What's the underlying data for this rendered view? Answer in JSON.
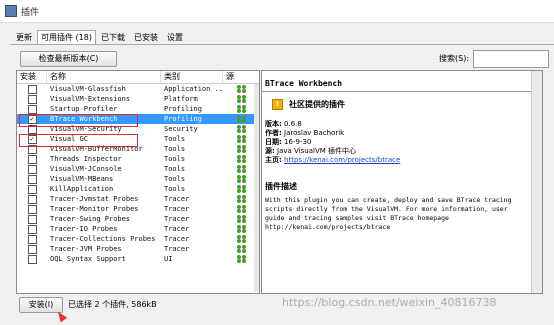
{
  "window": {
    "title": "插件"
  },
  "tabs": [
    "更新",
    "可用插件 (18)",
    "已下载",
    "已安装",
    "设置"
  ],
  "toolbar": {
    "check_label": "检查最新版本(C)",
    "search_label": "搜索(S):",
    "search_value": ""
  },
  "list": {
    "headers": {
      "install": "安装",
      "name": "名称",
      "category": "类别",
      "source": "源"
    },
    "rows": [
      {
        "checked": false,
        "name": "VisualVM-Glassfish",
        "category": "Application ...",
        "selected": false
      },
      {
        "checked": false,
        "name": "VisualVM-Extensions",
        "category": "Platform",
        "selected": false
      },
      {
        "checked": false,
        "name": "Startup Profiler",
        "category": "Profiling",
        "selected": false
      },
      {
        "checked": true,
        "name": "BTrace Workbench",
        "category": "Profiling",
        "selected": true
      },
      {
        "checked": false,
        "name": "VisualVM-Security",
        "category": "Security",
        "selected": false
      },
      {
        "checked": true,
        "name": "Visual GC",
        "category": "Tools",
        "selected": false
      },
      {
        "checked": false,
        "name": "VisualVM-BufferMonitor",
        "category": "Tools",
        "selected": false
      },
      {
        "checked": false,
        "name": "Threads Inspector",
        "category": "Tools",
        "selected": false
      },
      {
        "checked": false,
        "name": "VisualVM-JConsole",
        "category": "Tools",
        "selected": false
      },
      {
        "checked": false,
        "name": "VisualVM-MBeans",
        "category": "Tools",
        "selected": false
      },
      {
        "checked": false,
        "name": "KillApplication",
        "category": "Tools",
        "selected": false
      },
      {
        "checked": false,
        "name": "Tracer-Jvmstat Probes",
        "category": "Tracer",
        "selected": false
      },
      {
        "checked": false,
        "name": "Tracer-Monitor Probes",
        "category": "Tracer",
        "selected": false
      },
      {
        "checked": false,
        "name": "Tracer-Swing Probes",
        "category": "Tracer",
        "selected": false
      },
      {
        "checked": false,
        "name": "Tracer-IO Probes",
        "category": "Tracer",
        "selected": false
      },
      {
        "checked": false,
        "name": "Tracer-Collections Probes",
        "category": "Tracer",
        "selected": false
      },
      {
        "checked": false,
        "name": "Tracer-JVM Probes",
        "category": "Tracer",
        "selected": false
      },
      {
        "checked": false,
        "name": "OQL Syntax Support",
        "category": "UI",
        "selected": false
      }
    ]
  },
  "detail": {
    "title": "BTrace Workbench",
    "badge": "社区提供的插件",
    "version_label": "版本:",
    "version": "0.6.8",
    "author_label": "作者:",
    "author": "Jaroslav Bachorik",
    "date_label": "日期:",
    "date": "16-9-30",
    "source_label": "源:",
    "source": "Java VisualVM 插件中心",
    "homepage_label": "主页:",
    "homepage": "https://kenai.com/projects/btrace",
    "desc_title": "插件描述",
    "desc": "With this plugin you can create, deploy and save BTrace tracing scripts directly from the VisualVM. For more information, user guide and tracing samples visit BTrace homepage http://kenai.com/projects/btrace"
  },
  "footer": {
    "install_label": "安装(I)",
    "status": "已选择 2 个插件, 586kB"
  },
  "watermark": "https://blog.csdn.net/weixin_40816738",
  "colors": {
    "selection": "#3399ff",
    "highlight_box": "#e0292e",
    "arrow": "#e8312f",
    "link": "#1a44c2"
  }
}
